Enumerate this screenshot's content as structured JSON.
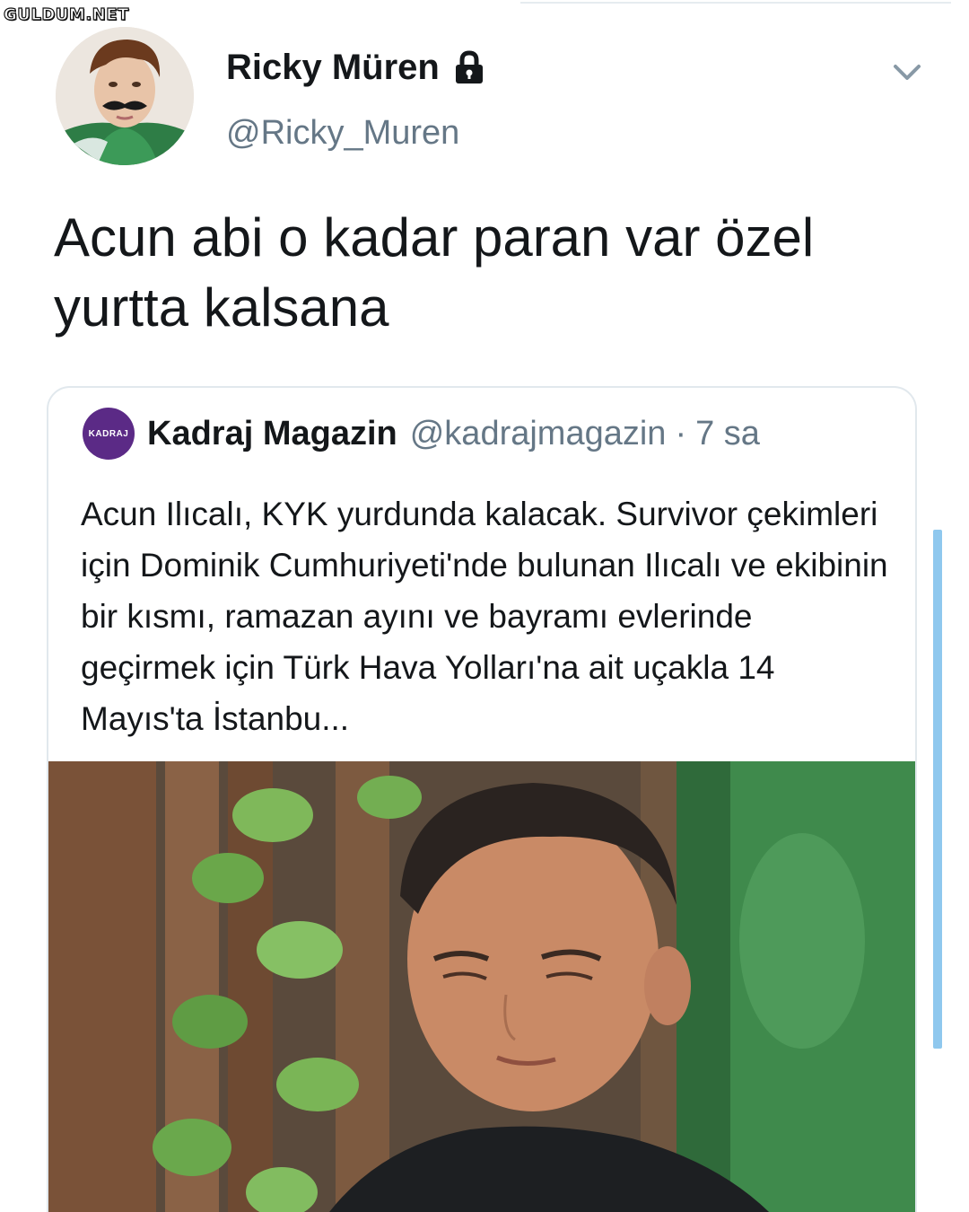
{
  "watermark": "GULDUM.NET",
  "tweet": {
    "author": {
      "display_name": "Ricky Müren",
      "handle": "@Ricky_Muren",
      "protected_icon": "lock-icon"
    },
    "menu_icon": "chevron-down-icon",
    "text": "Acun abi o kadar paran var özel yurtta kalsana"
  },
  "quoted_tweet": {
    "author": {
      "display_name": "Kadraj Magazin",
      "handle": "@kadrajmagazin",
      "avatar_text": "KADRAJ"
    },
    "separator": "·",
    "time": "7 sa",
    "text": "Acun Ilıcalı, KYK yurdunda kalacak. Survivor çekimleri için Dominik Cumhuriyeti'nde bulunan Ilıcalı ve ekibinin bir kısmı, ramazan ayını ve bayramı evlerinde geçirmek için Türk Hava Yolları'na ait uçakla 14 Mayıs'ta İstanbu..."
  },
  "colors": {
    "text": "#14171a",
    "secondary": "#657786",
    "border": "#e1e8ed",
    "kadraj_purple": "#5b2a86",
    "scrollbar": "#8fc8ee"
  }
}
